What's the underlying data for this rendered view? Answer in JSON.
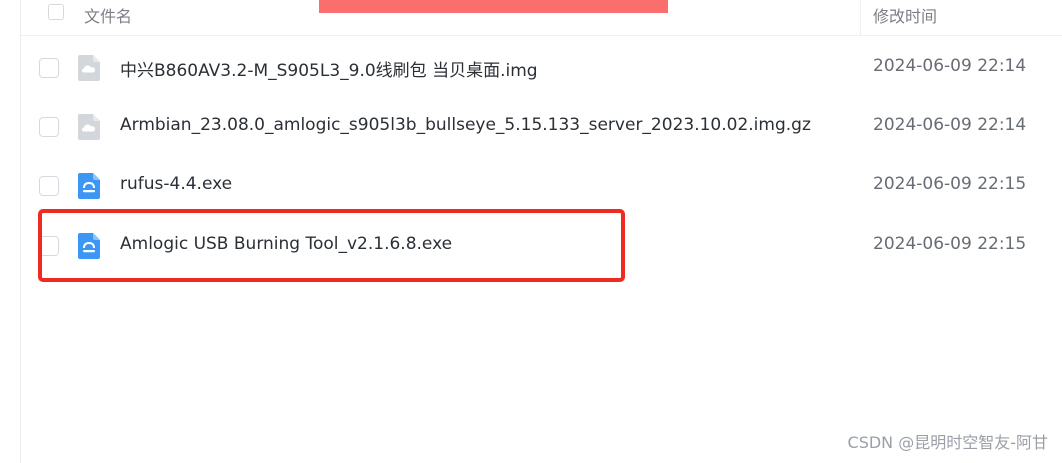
{
  "header": {
    "name_col": "文件名",
    "time_col": "修改时间"
  },
  "files": [
    {
      "name": "中兴B860AV3.2-M_S905L3_9.0线刷包 当贝桌面.img",
      "time": "2024-06-09 22:14",
      "icon": "cloud-file-icon"
    },
    {
      "name": "Armbian_23.08.0_amlogic_s905l3b_bullseye_5.15.133_server_2023.10.02.img.gz",
      "time": "2024-06-09 22:14",
      "icon": "cloud-file-icon"
    },
    {
      "name": "rufus-4.4.exe",
      "time": "2024-06-09 22:15",
      "icon": "exe-file-icon"
    },
    {
      "name": "Amlogic USB Burning Tool_v2.1.6.8.exe",
      "time": "2024-06-09 22:15",
      "icon": "exe-file-icon"
    }
  ],
  "watermark": "CSDN @昆明时空智友-阿甘",
  "colors": {
    "toast": "#fb6e6e",
    "highlight": "#ee2b22",
    "exe_icon": "#3c97f4",
    "cloud_icon": "#d3d7dc"
  }
}
